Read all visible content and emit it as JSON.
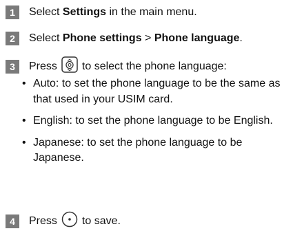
{
  "steps": [
    {
      "number": "1",
      "pre": "Select ",
      "bold": "Settings",
      "post": " in the main menu."
    },
    {
      "number": "2",
      "pre": "Select ",
      "bold1": "Phone settings",
      "sep": " > ",
      "bold2": "Phone language",
      "post": "."
    },
    {
      "number": "3",
      "pre": "Press",
      "post": "to select the phone language:",
      "icon": "navigation-key-icon"
    },
    {
      "number": "4",
      "pre": "Press",
      "post": "to save.",
      "icon": "ok-key-icon"
    }
  ],
  "bullets": [
    {
      "marker": "•",
      "text": "Auto: to set the phone language to be the same as that used in your USIM card."
    },
    {
      "marker": "•",
      "text": "English: to set the phone language to be English."
    },
    {
      "marker": "•",
      "text": "Japanese: to set the phone language to be Japanese."
    }
  ]
}
